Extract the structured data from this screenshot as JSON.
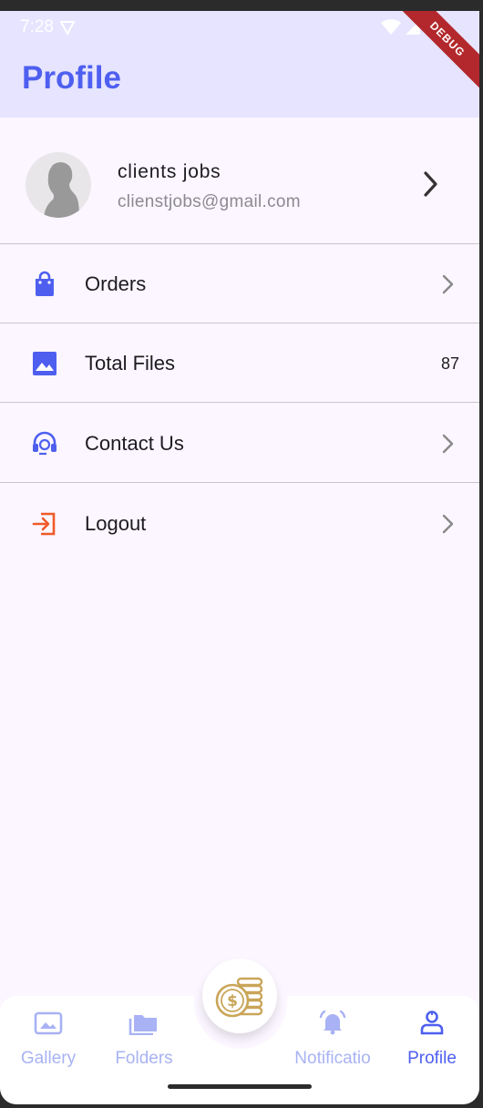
{
  "status_bar": {
    "time": "7:28",
    "debug_label": "DEBUG"
  },
  "app_bar": {
    "title": "Profile"
  },
  "profile": {
    "name": "clients jobs",
    "email": "clienstjobs@gmail.com"
  },
  "menu": {
    "orders": {
      "label": "Orders",
      "icon": "shopping-bag-icon"
    },
    "total_files": {
      "label": "Total Files",
      "count": "87",
      "icon": "image-icon"
    },
    "contact": {
      "label": "Contact Us",
      "icon": "headset-icon"
    },
    "logout": {
      "label": "Logout",
      "icon": "logout-icon"
    }
  },
  "bottom_nav": {
    "gallery": "Gallery",
    "folders": "Folders",
    "notifications": "Notificatio",
    "profile": "Profile",
    "active": "profile"
  },
  "colors": {
    "accent": "#4e5ff0",
    "accent_light": "#a8b2f4",
    "logout": "#f05a28",
    "app_bar_bg": "#e6e4ff",
    "page_bg": "#fbf6ff"
  }
}
